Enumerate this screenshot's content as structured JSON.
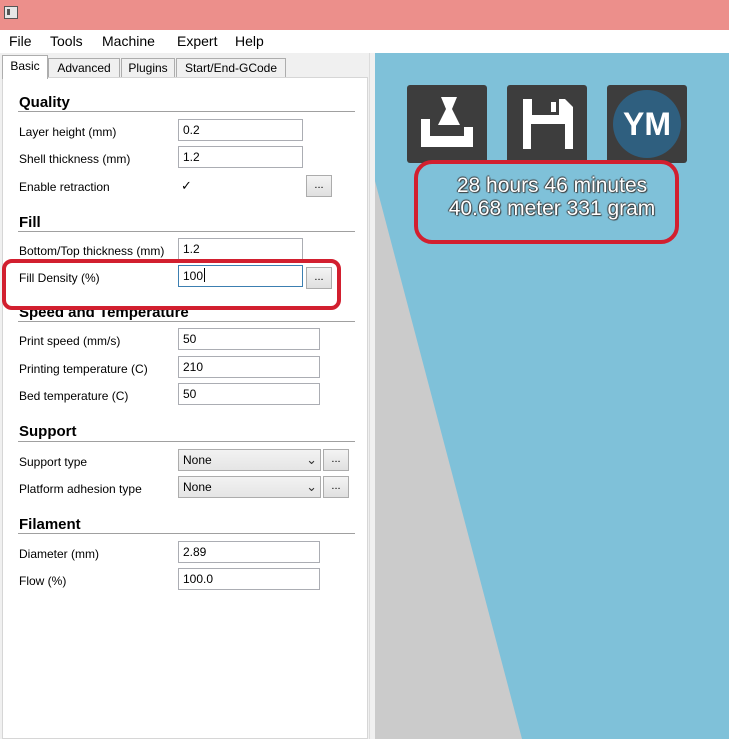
{
  "menu": {
    "items": [
      "File",
      "Tools",
      "Machine",
      "Expert",
      "Help"
    ]
  },
  "tabs": [
    "Basic",
    "Advanced",
    "Plugins",
    "Start/End-GCode"
  ],
  "quality": {
    "title": "Quality",
    "layer_height_label": "Layer height (mm)",
    "layer_height_value": "0.2",
    "shell_thickness_label": "Shell thickness (mm)",
    "shell_thickness_value": "1.2",
    "enable_retraction_label": "Enable retraction",
    "enable_retraction_checked": "✓",
    "more_label": "..."
  },
  "fill": {
    "title": "Fill",
    "bottom_top_label": "Bottom/Top thickness (mm)",
    "bottom_top_value": "1.2",
    "density_label": "Fill Density (%)",
    "density_value": "100",
    "more_label": "..."
  },
  "speed": {
    "title": "Speed and Temperature",
    "print_speed_label": "Print speed (mm/s)",
    "print_speed_value": "50",
    "printing_temp_label": "Printing temperature (C)",
    "printing_temp_value": "210",
    "bed_temp_label": "Bed temperature (C)",
    "bed_temp_value": "50"
  },
  "support": {
    "title": "Support",
    "type_label": "Support type",
    "type_value": "None",
    "adhesion_label": "Platform adhesion type",
    "adhesion_value": "None",
    "more_label": "..."
  },
  "filament": {
    "title": "Filament",
    "diameter_label": "Diameter (mm)",
    "diameter_value": "2.89",
    "flow_label": "Flow (%)",
    "flow_value": "100.0"
  },
  "viewport": {
    "ym_label": "YM",
    "print_time": "28 hours 46 minutes",
    "material": "40.68 meter 331 gram"
  },
  "colors": {
    "viewport_bg": "#7fc1d9",
    "titlebar": "#ec8f8b",
    "annotation": "#d21f2f",
    "tool_button": "#3d3d3d"
  },
  "icons": [
    "app-icon",
    "load-model-icon",
    "save-gcode-icon",
    "ym-icon",
    "chevron-down-icon",
    "checkmark-icon"
  ]
}
